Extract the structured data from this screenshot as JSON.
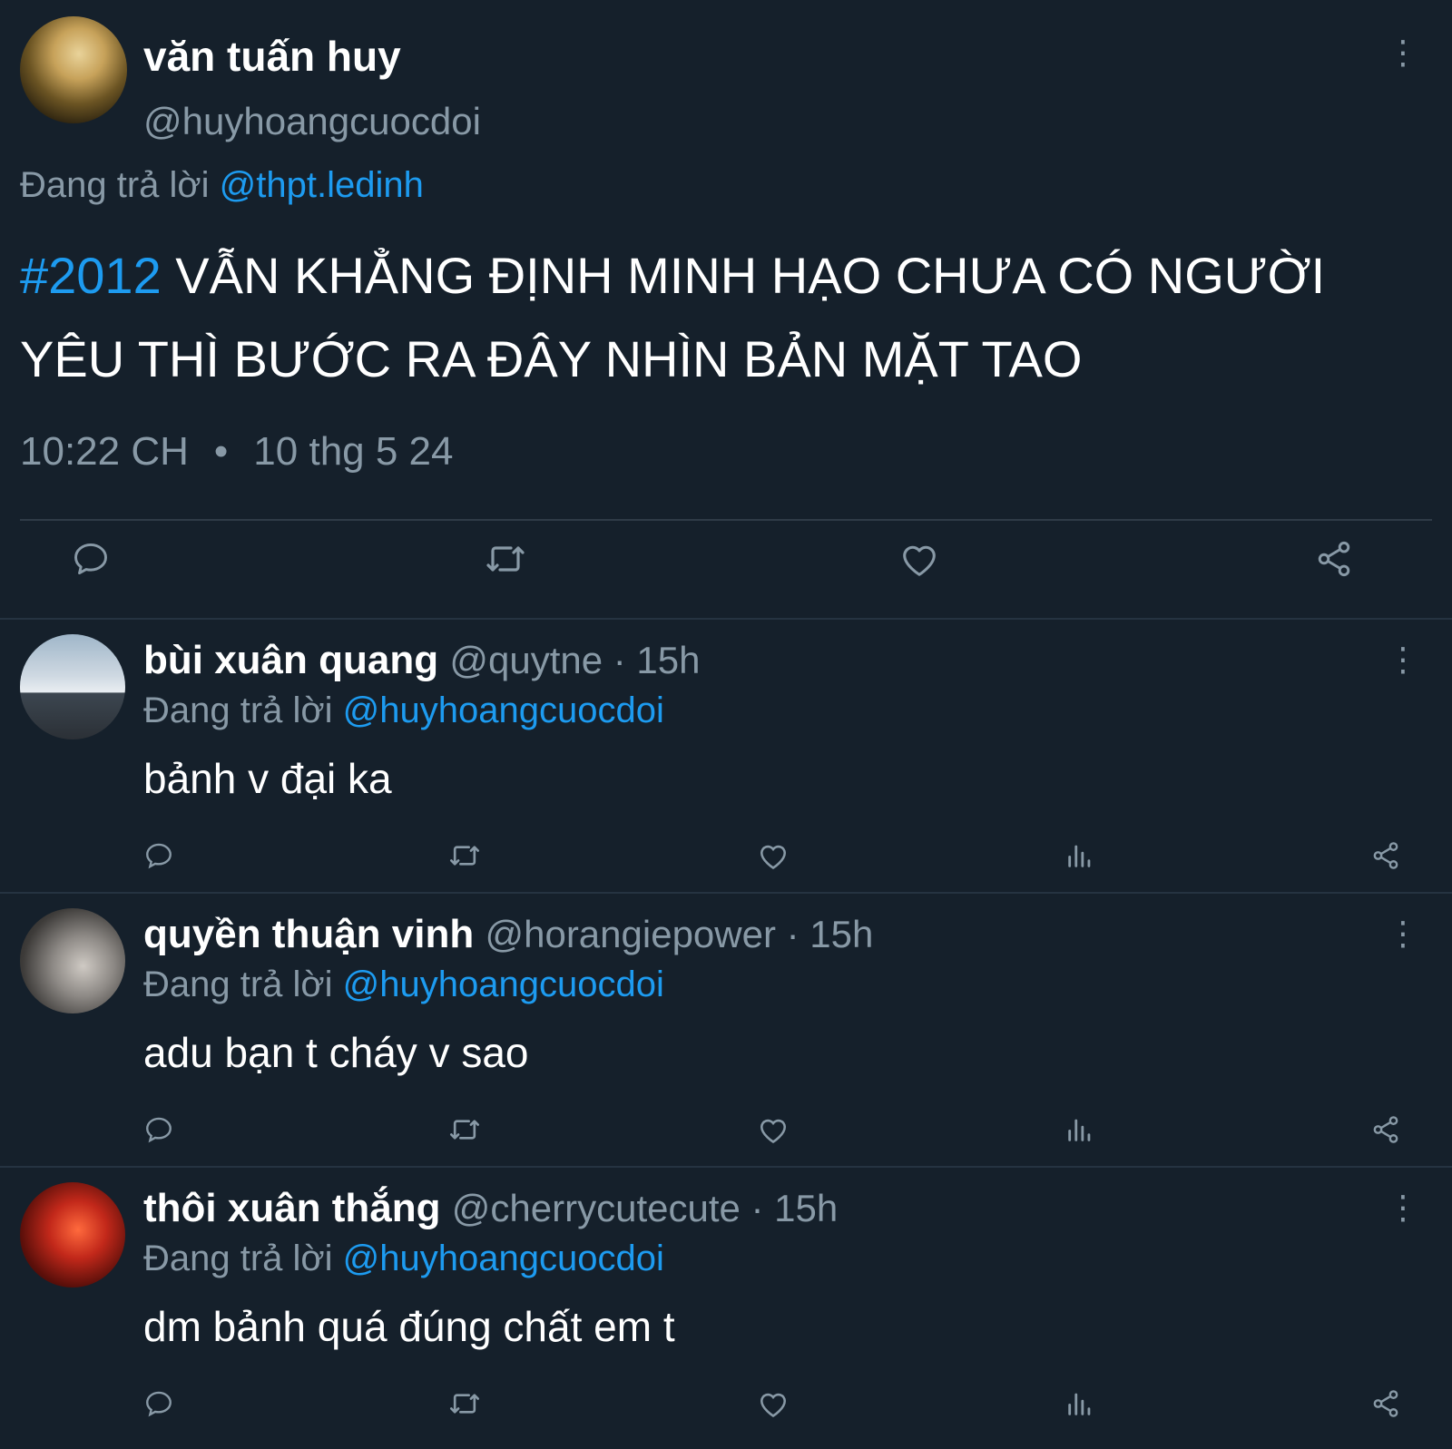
{
  "main_tweet": {
    "display_name": "văn tuấn huy",
    "handle": "@huyhoangcuocdoi",
    "replying_prefix": "Đang trả lời",
    "replying_to": "@thpt.ledinh",
    "hashtag": "#2012",
    "text": " VẪN KHẲNG ĐỊNH MINH HẠO CHƯA CÓ NGƯỜI YÊU THÌ BƯỚC RA ĐÂY NHÌN BẢN MẶT TAO",
    "time": "10:22 CH",
    "separator": "•",
    "date": "10 thg 5 24"
  },
  "replies": [
    {
      "display_name": "bùi xuân quang",
      "handle_time": "@quytne · 15h",
      "replying_prefix": "Đang trả lời",
      "replying_to": "@huyhoangcuocdoi",
      "text": "bảnh v đại ka"
    },
    {
      "display_name": "quyền thuận vinh",
      "handle_time": "@horangiepower · 15h",
      "replying_prefix": "Đang trả lời",
      "replying_to": "@huyhoangcuocdoi",
      "text": "adu bạn t cháy v sao"
    },
    {
      "display_name": "thôi xuân thắng",
      "handle_time": "@cherrycutecute · 15h",
      "replying_prefix": "Đang trả lời",
      "replying_to": "@huyhoangcuocdoi",
      "text": "dm bảnh quá đúng chất em t"
    }
  ],
  "colors": {
    "background": "#15202b",
    "accent": "#1d9bf0",
    "muted": "#8899a6",
    "divider": "#253341"
  },
  "icons": [
    "more-vertical-icon",
    "reply-icon",
    "retweet-icon",
    "like-icon",
    "views-icon",
    "share-icon"
  ]
}
